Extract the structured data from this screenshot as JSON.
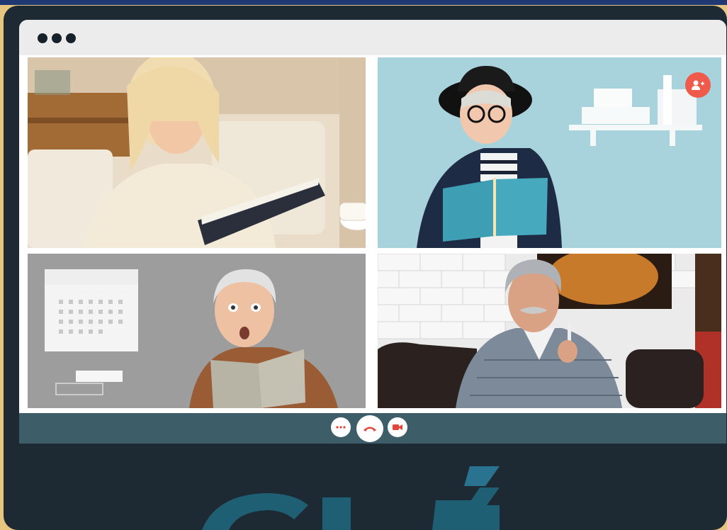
{
  "window": {
    "controls": [
      "window-dot",
      "window-dot",
      "window-dot"
    ]
  },
  "participants": [
    {
      "tile": "top-left",
      "description": "participant-1"
    },
    {
      "tile": "top-right",
      "description": "participant-2",
      "action_icon": "add-user-icon"
    },
    {
      "tile": "bottom-left",
      "description": "participant-3"
    },
    {
      "tile": "bottom-right",
      "description": "participant-4"
    }
  ],
  "call_controls": [
    {
      "icon": "more-options-icon"
    },
    {
      "icon": "end-call-icon",
      "color": "#e4453a"
    },
    {
      "icon": "video-camera-icon",
      "color": "#e4453a"
    }
  ],
  "colors": {
    "frame": "#1e2a33",
    "control_bar": "#3d5e68",
    "accent": "#ef5a4a",
    "background": "#e6c57f",
    "top_strip": "#1f3a72",
    "brand": "#2a6b80"
  }
}
